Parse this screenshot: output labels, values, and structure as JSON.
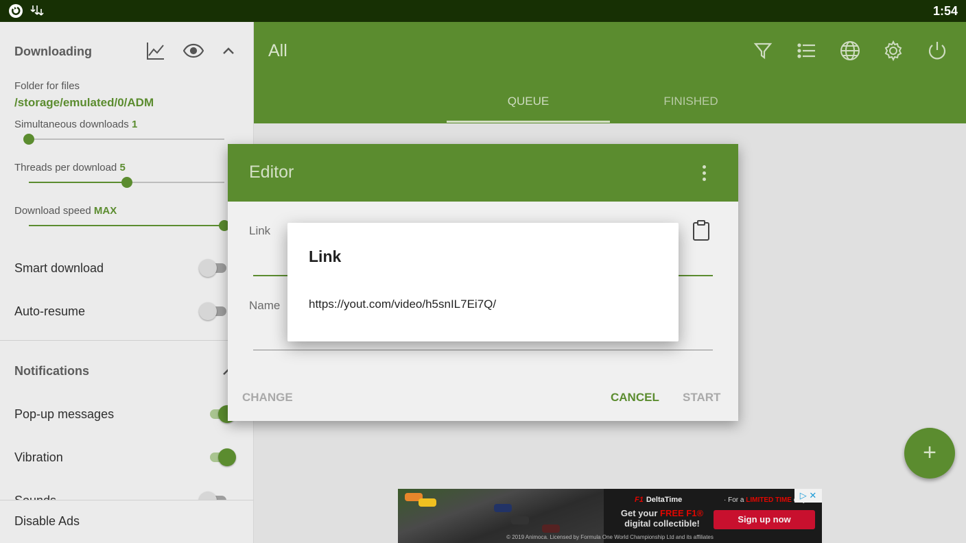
{
  "status_bar": {
    "icons": [
      "firefox-icon",
      "download-manager-icon"
    ],
    "time": "1:54"
  },
  "sidebar": {
    "downloading": {
      "title": "Downloading",
      "icons": [
        "chart-icon",
        "eye-icon",
        "chevron-up-icon"
      ],
      "folder_label": "Folder for files",
      "folder_path": "/storage/emulated/0/ADM",
      "simultaneous_label": "Simultaneous downloads",
      "simultaneous_value": "1",
      "simultaneous_fraction": 0.0,
      "threads_label": "Threads per download",
      "threads_value": "5",
      "threads_fraction": 0.5,
      "speed_label": "Download speed",
      "speed_value": "MAX",
      "speed_fraction": 1.0,
      "smart_download_label": "Smart download",
      "smart_download_on": false,
      "auto_resume_label": "Auto-resume",
      "auto_resume_on": false
    },
    "notifications": {
      "title": "Notifications",
      "popup_label": "Pop-up messages",
      "popup_on": true,
      "vibration_label": "Vibration",
      "vibration_on": true,
      "sounds_label": "Sounds",
      "sounds_on": false
    },
    "disable_ads_label": "Disable Ads"
  },
  "appbar": {
    "title": "All",
    "icons": [
      "filter-icon",
      "list-icon",
      "globe-icon",
      "settings-icon",
      "power-icon"
    ],
    "tabs": [
      {
        "label": "QUEUE",
        "active": true
      },
      {
        "label": "FINISHED",
        "active": false
      }
    ]
  },
  "editor": {
    "title": "Editor",
    "link_label": "Link",
    "name_label": "Name",
    "change_label": "CHANGE",
    "cancel_label": "CANCEL",
    "start_label": "START"
  },
  "link_dialog": {
    "title": "Link",
    "url": "https://yout.com/video/h5snIL7Ei7Q/"
  },
  "fab": {
    "icon": "plus-icon",
    "label": "+"
  },
  "ad": {
    "brand": "DeltaTime",
    "brand_prefix": "F1",
    "headline_1": "Get your",
    "headline_red": "FREE F1®",
    "headline_2": "digital collectible!",
    "promo_prefix": "· For a",
    "promo_red": "LIMITED TIME",
    "promo_suffix": "only",
    "cta": "Sign up now",
    "legal": "© 2019 Animoca. Licensed by Formula One World Championship Ltd and its affiliates",
    "adchoices": "▷ ✕"
  },
  "colors": {
    "accent": "#5b8c2f",
    "status_bar": "#173004",
    "ad_cta": "#c8102e"
  }
}
